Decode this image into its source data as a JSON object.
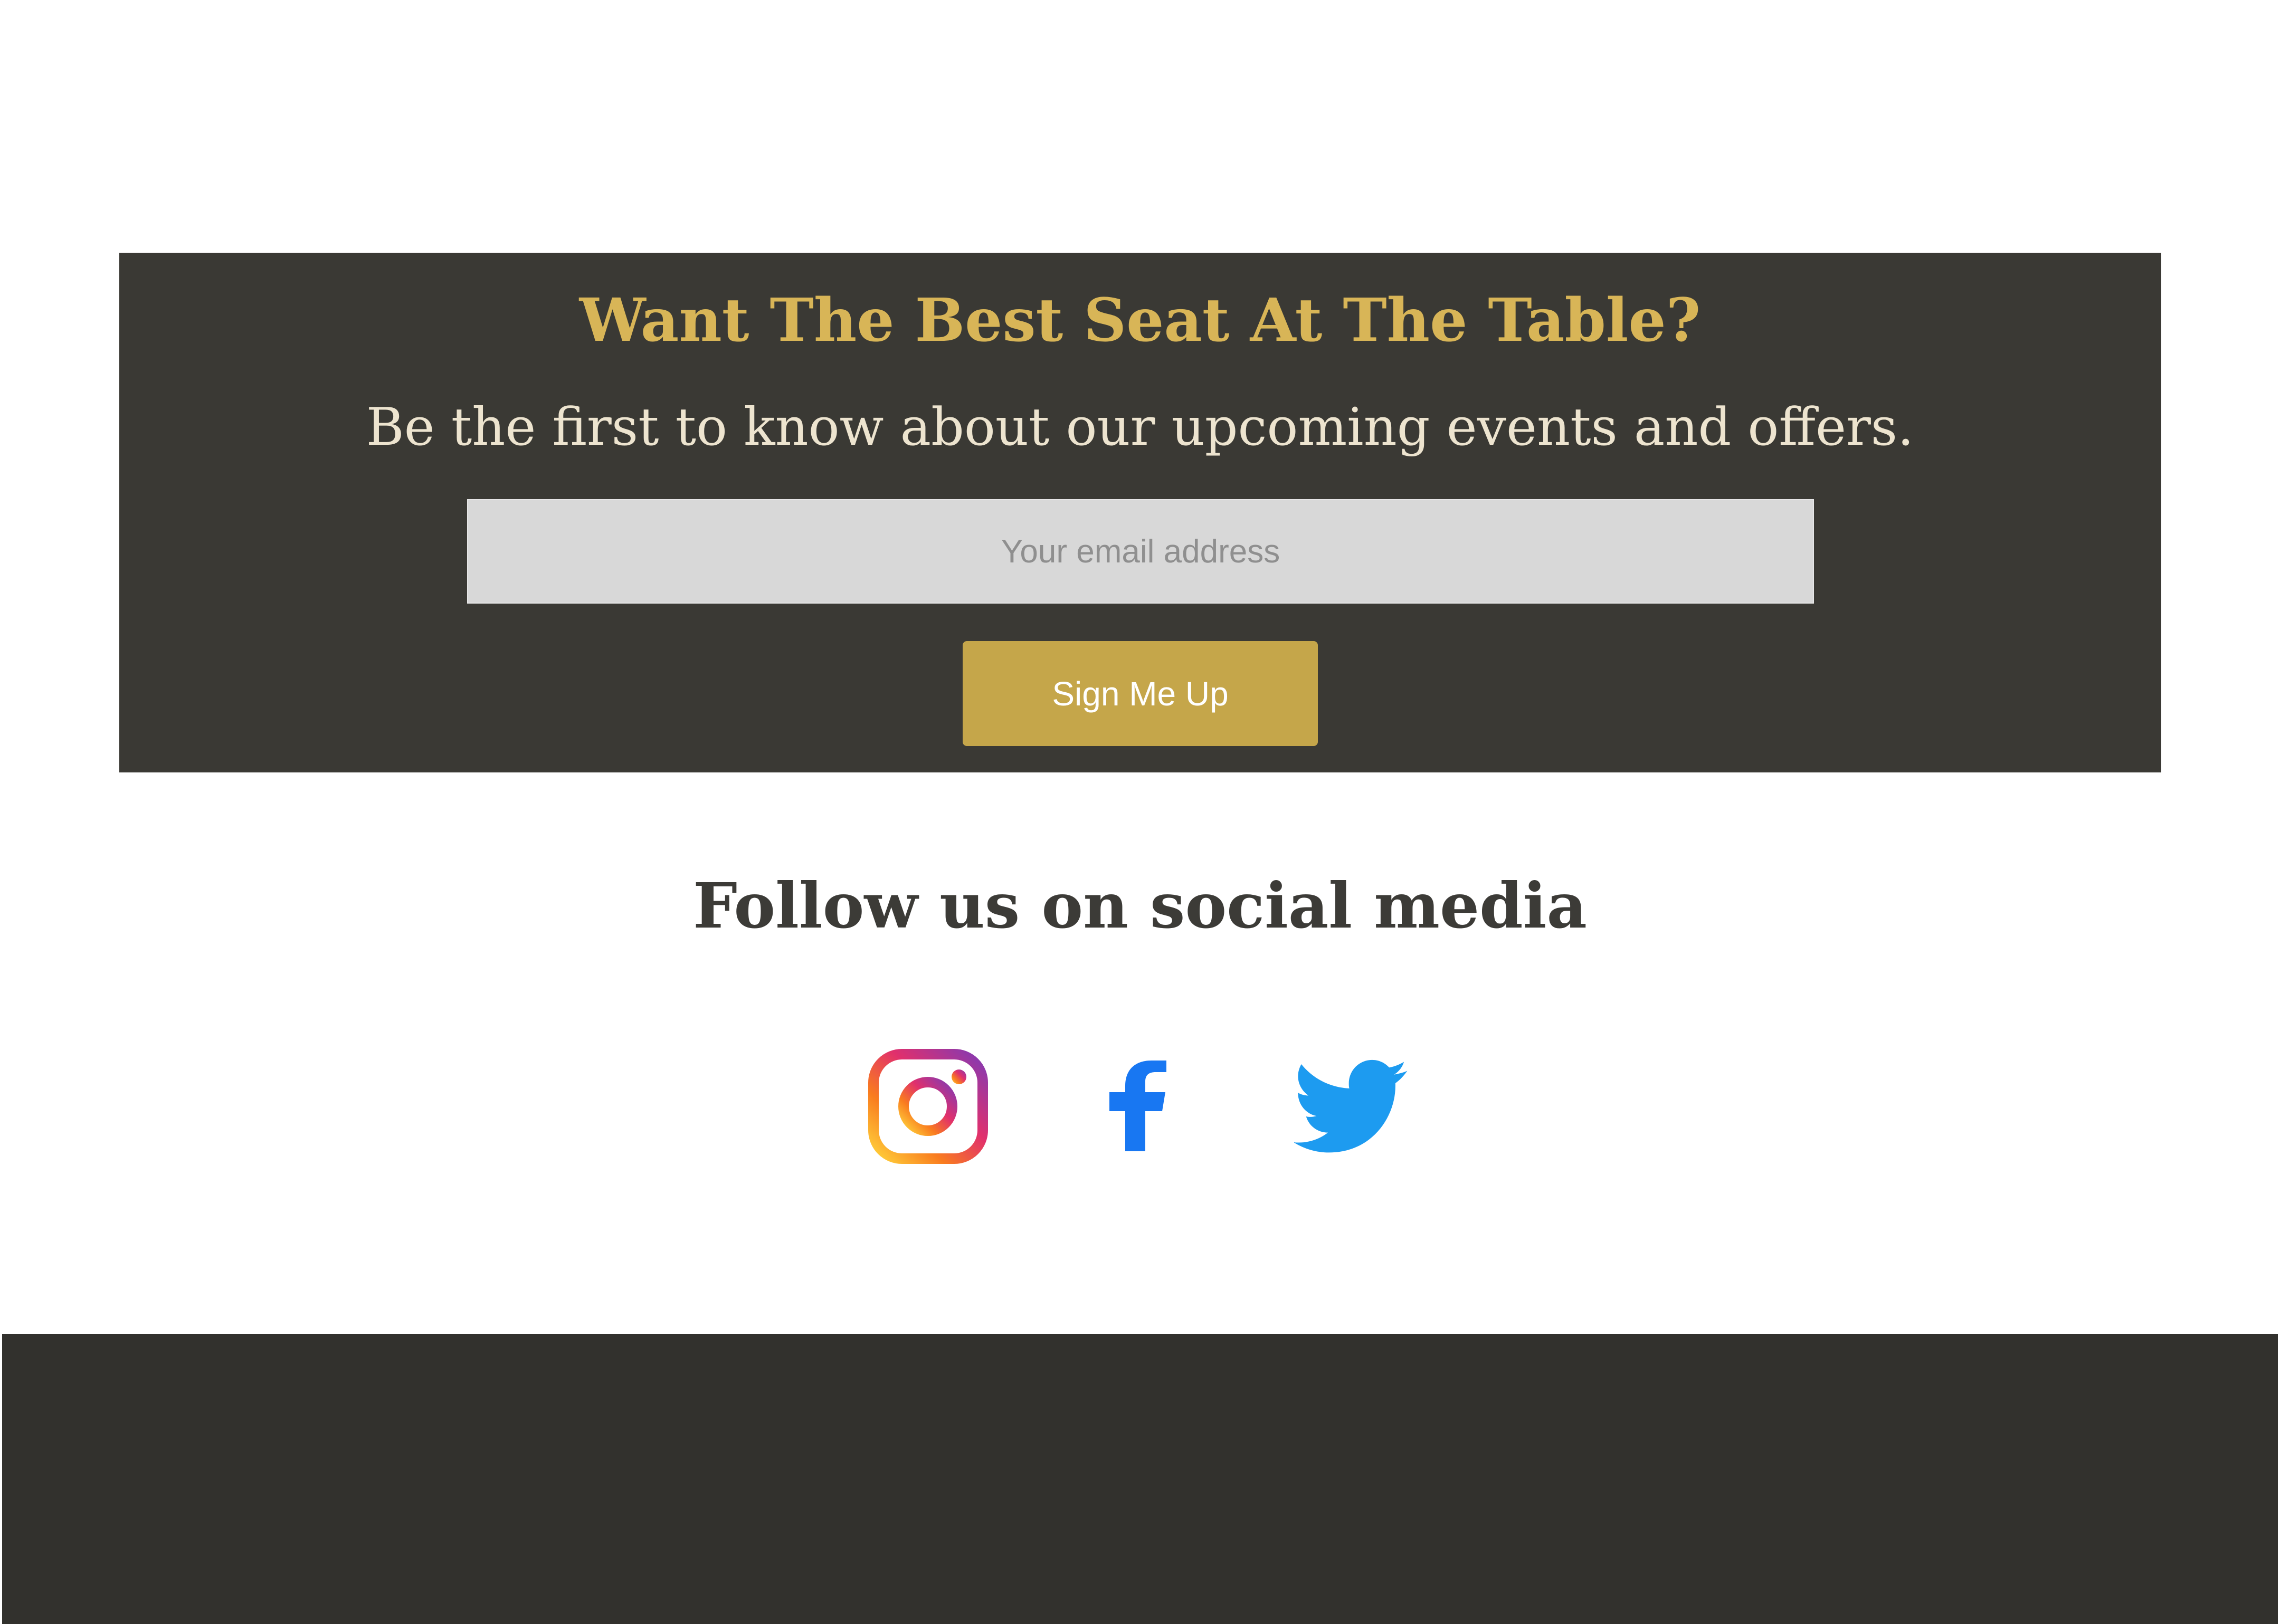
{
  "newsletter": {
    "title": "Want The Best Seat At The Table?",
    "subtitle": "Be the first to know about our upcoming events and offers.",
    "email_placeholder": "Your email address",
    "email_value": "",
    "button_label": "Sign Me Up"
  },
  "social": {
    "heading": "Follow us on social media",
    "links": [
      {
        "icon": "instagram-icon"
      },
      {
        "icon": "facebook-icon"
      },
      {
        "icon": "twitter-icon"
      }
    ]
  },
  "colors": {
    "panel_background": "#3a3934",
    "title_gold": "#d8b557",
    "subtitle_cream": "#ede4cf",
    "button_gold": "#c5a64a",
    "footer_background": "#32312d",
    "facebook_blue": "#1877f2",
    "twitter_blue": "#1d9bf0"
  }
}
